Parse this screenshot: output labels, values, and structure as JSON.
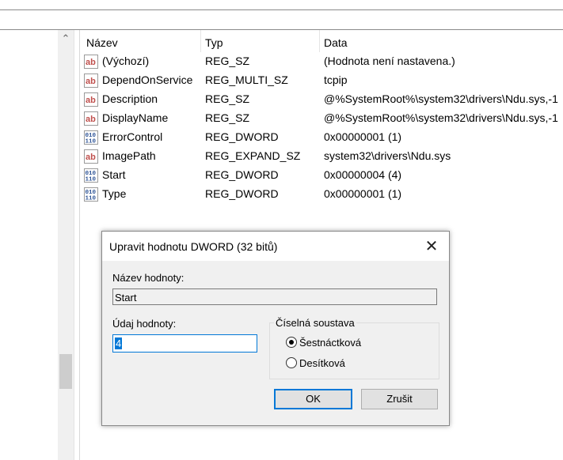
{
  "list": {
    "columns": [
      "Název",
      "Typ",
      "Data"
    ],
    "rows": [
      {
        "icon": "string-value-icon",
        "name": "(Výchozí)",
        "type": "REG_SZ",
        "data": "(Hodnota není nastavena.)"
      },
      {
        "icon": "string-value-icon",
        "name": "DependOnService",
        "type": "REG_MULTI_SZ",
        "data": "tcpip"
      },
      {
        "icon": "string-value-icon",
        "name": "Description",
        "type": "REG_SZ",
        "data": "@%SystemRoot%\\system32\\drivers\\Ndu.sys,-1"
      },
      {
        "icon": "string-value-icon",
        "name": "DisplayName",
        "type": "REG_SZ",
        "data": "@%SystemRoot%\\system32\\drivers\\Ndu.sys,-1"
      },
      {
        "icon": "binary-value-icon",
        "name": "ErrorControl",
        "type": "REG_DWORD",
        "data": "0x00000001 (1)"
      },
      {
        "icon": "string-value-icon",
        "name": "ImagePath",
        "type": "REG_EXPAND_SZ",
        "data": "system32\\drivers\\Ndu.sys"
      },
      {
        "icon": "binary-value-icon",
        "name": "Start",
        "type": "REG_DWORD",
        "data": "0x00000004 (4)"
      },
      {
        "icon": "binary-value-icon",
        "name": "Type",
        "type": "REG_DWORD",
        "data": "0x00000001 (1)"
      }
    ]
  },
  "dialog": {
    "title": "Upravit hodnotu DWORD (32 bitů)",
    "name_label": "Název hodnoty:",
    "name_value": "Start",
    "value_label": "Údaj hodnoty:",
    "value": "4",
    "base_label": "Číselná soustava",
    "base_options": [
      "Šestnáctková",
      "Desítková"
    ],
    "base_selected": "Šestnáctková",
    "ok_label": "OK",
    "cancel_label": "Zrušit",
    "close_glyph": "✕"
  },
  "colors": {
    "accent": "#0078d7",
    "dialog_bg": "#f0f0f0",
    "string_icon": "#c0504d",
    "binary_icon": "#2f5597"
  }
}
